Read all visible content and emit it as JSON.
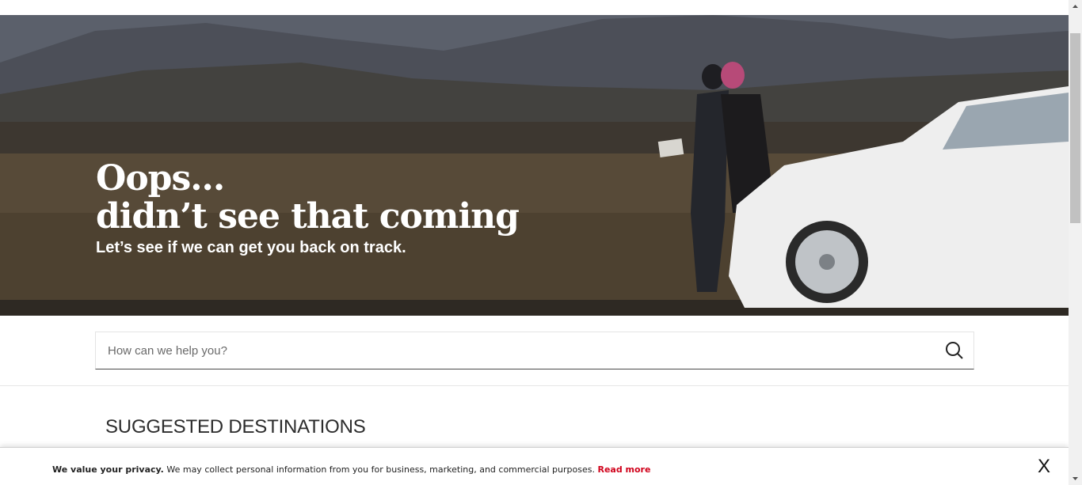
{
  "hero": {
    "title_line1": "Oops...",
    "title_line2": "didn’t see that coming",
    "subtitle": "Let’s see if we can get you back on track."
  },
  "search": {
    "placeholder": "How can we help you?",
    "value": "",
    "icon": "search-icon"
  },
  "section": {
    "title": "SUGGESTED DESTINATIONS"
  },
  "cookie": {
    "bold": "We value your privacy.",
    "text": " We may collect personal information from you for business, marketing, and commercial purposes. ",
    "link": "Read more",
    "close": "X"
  },
  "colors": {
    "link_red": "#d0021b",
    "text_dark": "#2c2c2c"
  }
}
